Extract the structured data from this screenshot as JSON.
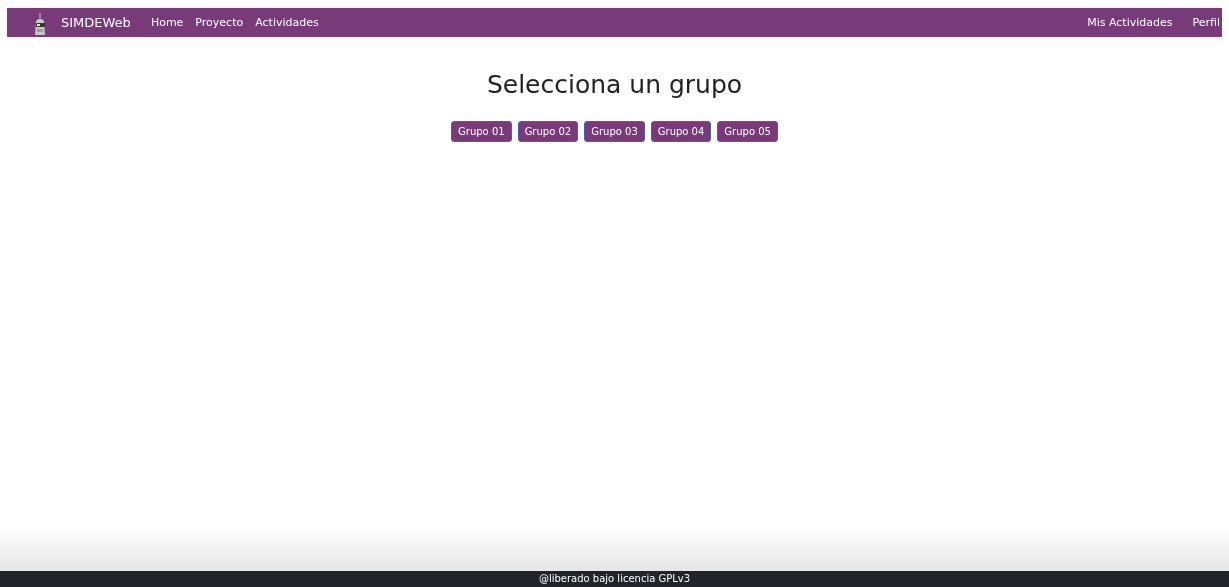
{
  "navbar": {
    "brand": "SIMDEWeb",
    "links": [
      "Home",
      "Proyecto",
      "Actividades"
    ],
    "right_links": [
      "Mis Actividades",
      "Perfil"
    ]
  },
  "heading": "Selecciona un grupo",
  "groups": [
    "Grupo 01",
    "Grupo 02",
    "Grupo 03",
    "Grupo 04",
    "Grupo 05"
  ],
  "footer": "@liberado bajo licencia GPLv3"
}
